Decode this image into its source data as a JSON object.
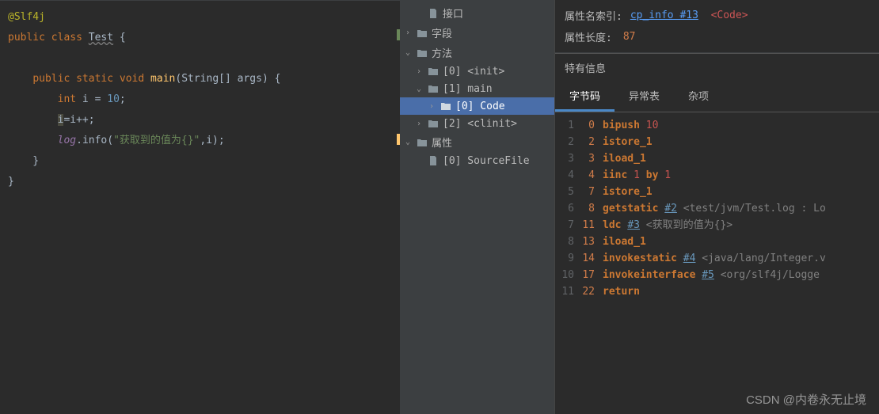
{
  "editor": {
    "annotation": "@Slf4j",
    "l2_public": "public",
    "l2_class": "class",
    "l2_name": "Test",
    "l2_brace": " {",
    "l4_pad": "    ",
    "l4_public": "public",
    "l4_static": "static",
    "l4_void": "void",
    "l4_main": "main",
    "l4_lparen": "(",
    "l4_type": "String[]",
    "l4_args": " args",
    "l4_rparen": ") {",
    "l5_pad": "        ",
    "l5_int": "int",
    "l5_rest": " i = ",
    "l5_num": "10",
    "l5_semi": ";",
    "l6_pad": "        ",
    "l6_i": "i",
    "l6_rest": "=i++;",
    "l7_pad": "        ",
    "l7_log": "log",
    "l7_dot": ".",
    "l7_info": "info",
    "l7_lparen": "(",
    "l7_str": "\"获取到的值为{}\"",
    "l7_rest": ",i);",
    "l8": "    }",
    "l9": "}"
  },
  "tree": {
    "t1": "接口",
    "t2": "字段",
    "t3": "方法",
    "t4": "[0] <init>",
    "t5": "[1] main",
    "t6": "[0] Code",
    "t7": "[2] <clinit>",
    "t8": "属性",
    "t9": "[0] SourceFile"
  },
  "info": {
    "attr_name_label": "属性名索引:",
    "attr_name_link": "cp_info #13",
    "attr_name_code": "<Code>",
    "attr_len_label": "属性长度:",
    "attr_len_val": "87",
    "special_label": "特有信息"
  },
  "tabs": {
    "t1": "字节码",
    "t2": "异常表",
    "t3": "杂项"
  },
  "bytecode": [
    {
      "ln": "1",
      "off": "0",
      "instr": "bipush",
      "args": [
        {
          "t": "num",
          "v": "10"
        }
      ]
    },
    {
      "ln": "2",
      "off": "2",
      "instr": "istore_1",
      "args": []
    },
    {
      "ln": "3",
      "off": "3",
      "instr": "iload_1",
      "args": []
    },
    {
      "ln": "4",
      "off": "4",
      "instr": "iinc",
      "args": [
        {
          "t": "num",
          "v": "1"
        },
        {
          "t": "kw",
          "v": "by"
        },
        {
          "t": "num",
          "v": "1"
        }
      ]
    },
    {
      "ln": "5",
      "off": "7",
      "instr": "istore_1",
      "args": []
    },
    {
      "ln": "6",
      "off": "8",
      "instr": "getstatic",
      "args": [
        {
          "t": "ref",
          "v": "#2"
        },
        {
          "t": "comment",
          "v": "<test/jvm/Test.log : Lo"
        }
      ]
    },
    {
      "ln": "7",
      "off": "11",
      "instr": "ldc",
      "args": [
        {
          "t": "ref",
          "v": "#3"
        },
        {
          "t": "comment",
          "v": "<获取到的值为{}>"
        }
      ]
    },
    {
      "ln": "8",
      "off": "13",
      "instr": "iload_1",
      "args": []
    },
    {
      "ln": "9",
      "off": "14",
      "instr": "invokestatic",
      "args": [
        {
          "t": "ref",
          "v": "#4"
        },
        {
          "t": "comment",
          "v": "<java/lang/Integer.v"
        }
      ]
    },
    {
      "ln": "10",
      "off": "17",
      "instr": "invokeinterface",
      "args": [
        {
          "t": "ref",
          "v": "#5"
        },
        {
          "t": "comment",
          "v": "<org/slf4j/Logge"
        }
      ]
    },
    {
      "ln": "11",
      "off": "22",
      "instr": "return",
      "args": []
    }
  ],
  "watermark": "CSDN @内卷永无止境"
}
